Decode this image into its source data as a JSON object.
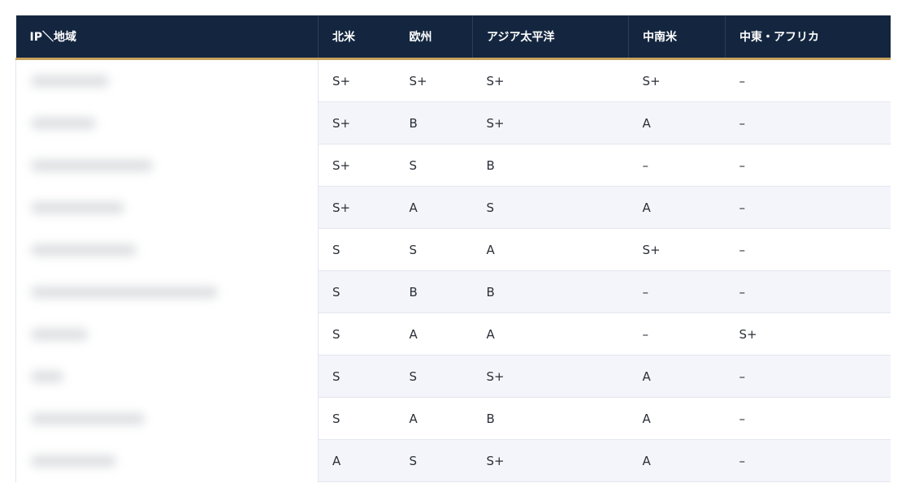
{
  "table": {
    "headers": [
      "IP＼地域",
      "北米",
      "欧州",
      "アジア太平洋",
      "中南米",
      "中東・アフリカ"
    ],
    "rows": [
      [
        "S+",
        "S+",
        "S+",
        "S+",
        "–"
      ],
      [
        "S+",
        "B",
        "S+",
        "A",
        "–"
      ],
      [
        "S+",
        "S",
        "B",
        "–",
        "–"
      ],
      [
        "S+",
        "A",
        "S",
        "A",
        "–"
      ],
      [
        "S",
        "S",
        "A",
        "S+",
        "–"
      ],
      [
        "S",
        "B",
        "B",
        "–",
        "–"
      ],
      [
        "S",
        "A",
        "A",
        "–",
        "S+"
      ],
      [
        "S",
        "S",
        "S+",
        "A",
        "–"
      ],
      [
        "S",
        "A",
        "B",
        "A",
        "–"
      ],
      [
        "A",
        "S",
        "S+",
        "A",
        "–"
      ]
    ]
  },
  "colors": {
    "header_bg": "#14263f",
    "header_text": "#ffffff",
    "accent_border": "#c8a25a",
    "row_alt_bg": "#f4f5fa"
  }
}
